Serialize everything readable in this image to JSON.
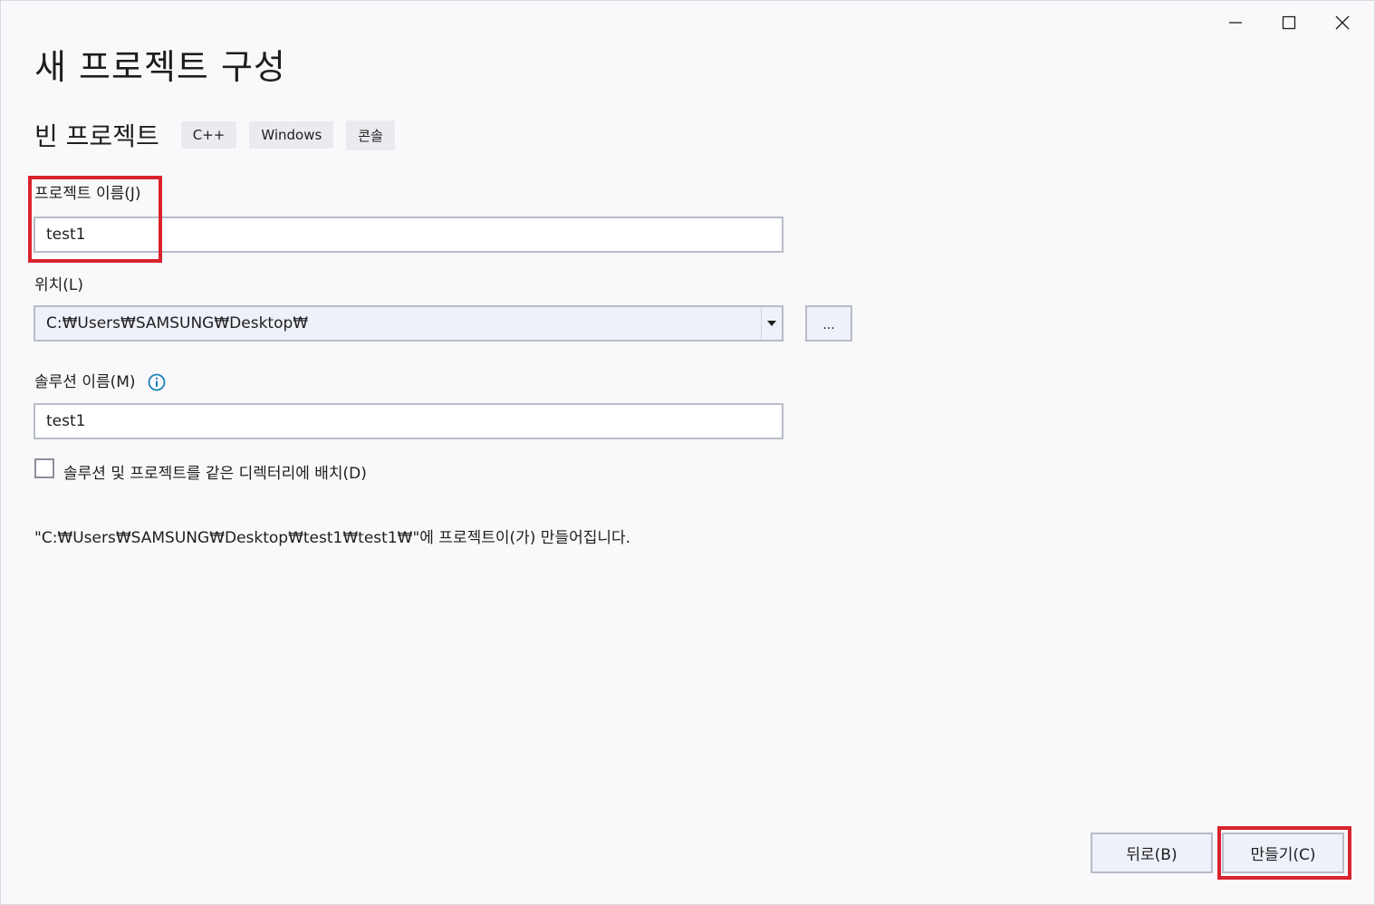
{
  "window": {
    "title": "새 프로젝트 구성",
    "controls": [
      "minimize-icon",
      "maximize-icon",
      "close-icon"
    ]
  },
  "template": {
    "name": "빈 프로젝트",
    "tags": [
      "C++",
      "Windows",
      "콘솔"
    ]
  },
  "form": {
    "project_name_label": "프로젝트 이름(J)",
    "project_name_value": "test1",
    "location_label": "위치(L)",
    "location_value": "C:₩Users₩SAMSUNG₩Desktop₩",
    "browse_label": "...",
    "solution_name_label": "솔루션 이름(M)",
    "solution_name_value": "test1",
    "same_dir_checkbox_label": "솔루션 및 프로젝트를 같은 디렉터리에 배치(D)",
    "same_dir_checked": false,
    "result_message": "\"C:₩Users₩SAMSUNG₩Desktop₩test1₩test1₩\"에 프로젝트이(가) 만들어집니다."
  },
  "footer": {
    "back_label": "뒤로(B)",
    "create_label": "만들기(C)"
  },
  "colors": {
    "highlight": "#d9232e",
    "background": "#f9f9fb",
    "info_icon": "#1a7fb8"
  }
}
